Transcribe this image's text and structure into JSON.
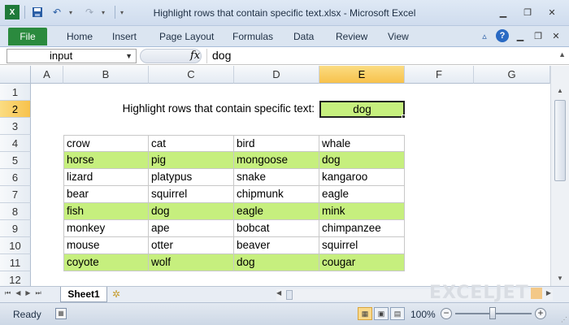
{
  "app": {
    "title": "Highlight rows that contain specific text.xlsx - Microsoft Excel"
  },
  "ribbon": {
    "file_label": "File",
    "tabs": [
      "Home",
      "Insert",
      "Page Layout",
      "Formulas",
      "Data",
      "Review",
      "View"
    ]
  },
  "formula_bar": {
    "name_box": "input",
    "fx_label": "fx",
    "formula": "dog"
  },
  "columns": [
    "A",
    "B",
    "C",
    "D",
    "E",
    "F",
    "G"
  ],
  "active_column": "E",
  "rows": [
    "1",
    "2",
    "3",
    "4",
    "5",
    "6",
    "7",
    "8",
    "9",
    "10",
    "11",
    "12"
  ],
  "active_row": "2",
  "sheet": {
    "prompt": "Highlight rows that contain specific text:",
    "search_value": "dog",
    "highlight_color": "#c6ef7e",
    "table": [
      {
        "cells": [
          "crow",
          "cat",
          "bird",
          "whale"
        ],
        "highlighted": false
      },
      {
        "cells": [
          "horse",
          "pig",
          "mongoose",
          "dog"
        ],
        "highlighted": true
      },
      {
        "cells": [
          "lizard",
          "platypus",
          "snake",
          "kangaroo"
        ],
        "highlighted": false
      },
      {
        "cells": [
          "bear",
          "squirrel",
          "chipmunk",
          "eagle"
        ],
        "highlighted": false
      },
      {
        "cells": [
          "fish",
          "dog",
          "eagle",
          "mink"
        ],
        "highlighted": true
      },
      {
        "cells": [
          "monkey",
          "ape",
          "bobcat",
          "chimpanzee"
        ],
        "highlighted": false
      },
      {
        "cells": [
          "mouse",
          "otter",
          "beaver",
          "squirrel"
        ],
        "highlighted": false
      },
      {
        "cells": [
          "coyote",
          "wolf",
          "dog",
          "cougar"
        ],
        "highlighted": true
      }
    ]
  },
  "sheet_tabs": {
    "active": "Sheet1"
  },
  "watermark": "EXCELJET",
  "status": {
    "ready": "Ready",
    "zoom": "100%"
  }
}
